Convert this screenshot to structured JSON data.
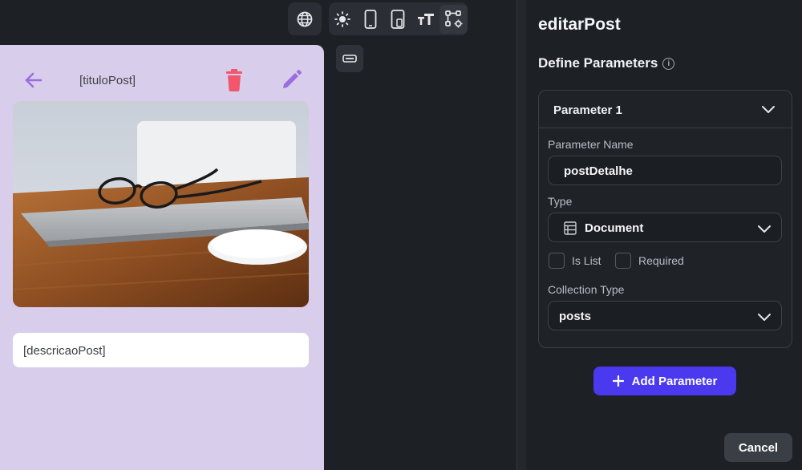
{
  "toolbar": {
    "left_group": [
      {
        "icon": "globe-icon"
      }
    ],
    "right_group": [
      {
        "icon": "sun-icon"
      },
      {
        "icon": "phone-icon"
      },
      {
        "icon": "tablet-icon"
      },
      {
        "icon": "text-size-icon"
      },
      {
        "icon": "flow-settings-icon"
      }
    ],
    "mini_chip_icon": "widget-icon"
  },
  "preview": {
    "app_title": "[tituloPost]",
    "back_icon": "arrow-left-icon",
    "delete_icon": "trash-icon",
    "edit_icon": "pencil-icon",
    "description": "[descricaoPost]",
    "colors": {
      "background": "#d8cdea",
      "accent": "#9a6ee0",
      "delete": "#f2566a"
    }
  },
  "panel": {
    "title": "editarPost",
    "section_title": "Define Parameters",
    "parameter": {
      "header": "Parameter 1",
      "name_label": "Parameter Name",
      "name_value": "postDetalhe",
      "type_label": "Type",
      "type_value": "Document",
      "is_list_label": "Is List",
      "required_label": "Required",
      "collection_label": "Collection Type",
      "collection_value": "posts"
    },
    "add_button": "Add Parameter",
    "cancel_button": "Cancel",
    "colors": {
      "primary": "#4b39ef"
    }
  }
}
